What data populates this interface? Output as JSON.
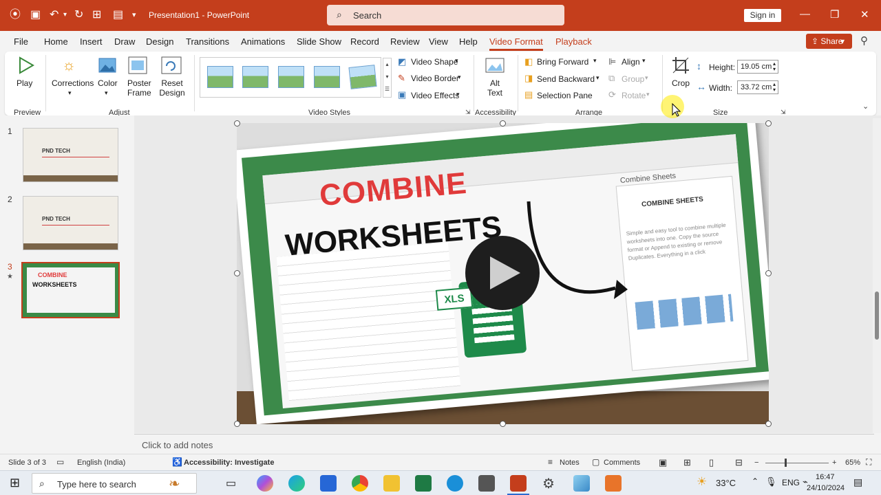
{
  "titlebar": {
    "doc_title": "Presentation1  -  PowerPoint",
    "search_placeholder": "Search",
    "sign_in": "Sign in",
    "accent_color": "#c43e1c"
  },
  "menu": {
    "items": [
      "File",
      "Home",
      "Insert",
      "Draw",
      "Design",
      "Transitions",
      "Animations",
      "Slide Show",
      "Record",
      "Review",
      "View",
      "Help",
      "Video Format",
      "Playback"
    ],
    "active": "Video Format",
    "share": "Share"
  },
  "ribbon": {
    "preview": {
      "play": "Play",
      "group": "Preview"
    },
    "adjust": {
      "corrections": "Corrections",
      "color": "Color",
      "poster_frame": "Poster Frame",
      "reset_design": "Reset Design",
      "group": "Adjust"
    },
    "video_styles": {
      "video_shape": "Video Shape",
      "video_border": "Video Border",
      "video_effects": "Video Effects",
      "group": "Video Styles"
    },
    "accessibility": {
      "alt_text": "Alt Text",
      "group": "Accessibility"
    },
    "arrange": {
      "bring_forward": "Bring Forward",
      "send_backward": "Send Backward",
      "selection_pane": "Selection Pane",
      "align": "Align",
      "group_btn": "Group",
      "rotate": "Rotate",
      "group": "Arrange"
    },
    "size": {
      "crop": "Crop",
      "height_label": "Height:",
      "height_value": "19.05 cm",
      "width_label": "Width:",
      "width_value": "33.72 cm",
      "group": "Size"
    }
  },
  "slides": [
    {
      "num": "1",
      "title": "PND TECH"
    },
    {
      "num": "2",
      "title": "PND TECH"
    },
    {
      "num": "3",
      "title": "COMBINE",
      "subtitle": "WORKSHEETS"
    }
  ],
  "slide": {
    "title_line1": "COMBINE",
    "title_line2": "WORKSHEETS",
    "xls_label": "XLS",
    "panel_title": "Combine Sheets",
    "panel_heading": "COMBINE SHEETS",
    "panel_text": "Simple and easy tool to combine multiple worksheets into one. Copy the source format or Append to existing or remove Duplicates. Everything in a click"
  },
  "notes_placeholder": "Click to add notes",
  "status": {
    "slide_info": "Slide 3 of 3",
    "language": "English (India)",
    "accessibility": "Accessibility: Investigate",
    "notes": "Notes",
    "comments": "Comments",
    "zoom": "65%"
  },
  "taskbar": {
    "search_placeholder": "Type here to search",
    "temperature": "33°C",
    "lang": "ENG",
    "time": "16:47",
    "date": "24/10/2024"
  }
}
